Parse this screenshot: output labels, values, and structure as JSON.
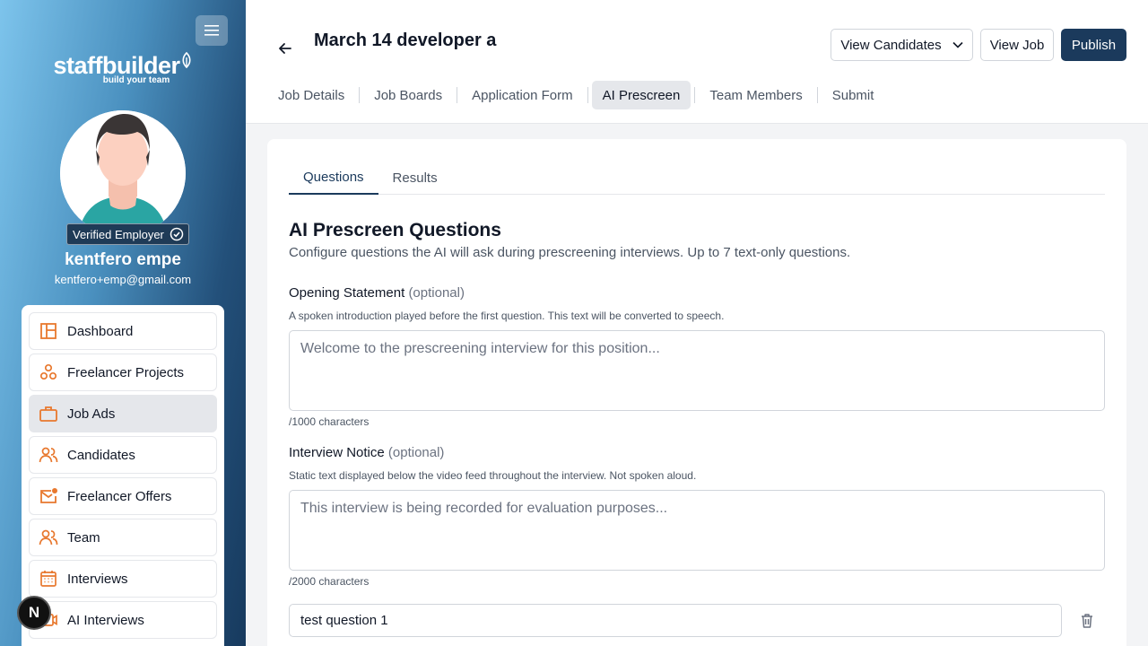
{
  "sidebar": {
    "logo_main": "staffbuilder",
    "logo_sub": "build your team",
    "verified_label": "Verified Employer",
    "user_name": "kentfero empe",
    "user_email": "kentfero+emp@gmail.com",
    "items": [
      {
        "label": "Dashboard",
        "icon": "dashboard-icon"
      },
      {
        "label": "Freelancer Projects",
        "icon": "projects-icon"
      },
      {
        "label": "Job Ads",
        "icon": "briefcase-icon",
        "active": true
      },
      {
        "label": "Candidates",
        "icon": "users-icon"
      },
      {
        "label": "Freelancer Offers",
        "icon": "mail-icon"
      },
      {
        "label": "Team",
        "icon": "team-icon"
      },
      {
        "label": "Interviews",
        "icon": "calendar-icon"
      },
      {
        "label": "AI Interviews",
        "icon": "ai-icon"
      }
    ],
    "badge_letter": "N"
  },
  "header": {
    "title": "March 14 developer a",
    "view_candidates": "View Candidates",
    "view_job": "View Job",
    "publish": "Publish",
    "tabs": [
      "Job Details",
      "Job Boards",
      "Application Form",
      "AI Prescreen",
      "Team Members",
      "Submit"
    ],
    "active_tab": "AI Prescreen"
  },
  "content": {
    "sub_tabs": [
      "Questions",
      "Results"
    ],
    "active_sub_tab": "Questions",
    "title": "AI Prescreen Questions",
    "description": "Configure questions the AI will ask during prescreening interviews. Up to 7 text-only questions.",
    "opening": {
      "label": "Opening Statement",
      "optional": "(optional)",
      "help": "A spoken introduction played before the first question. This text will be converted to speech.",
      "placeholder": "Welcome to the prescreening interview for this position...",
      "count": "/1000 characters"
    },
    "notice": {
      "label": "Interview Notice",
      "optional": "(optional)",
      "help": "Static text displayed below the video feed throughout the interview. Not spoken aloud.",
      "placeholder": "This interview is being recorded for evaluation purposes...",
      "count": "/2000 characters"
    },
    "question_1": "test question 1"
  },
  "colors": {
    "primary": "#1b3a5c",
    "icon_orange": "#e8782e"
  }
}
